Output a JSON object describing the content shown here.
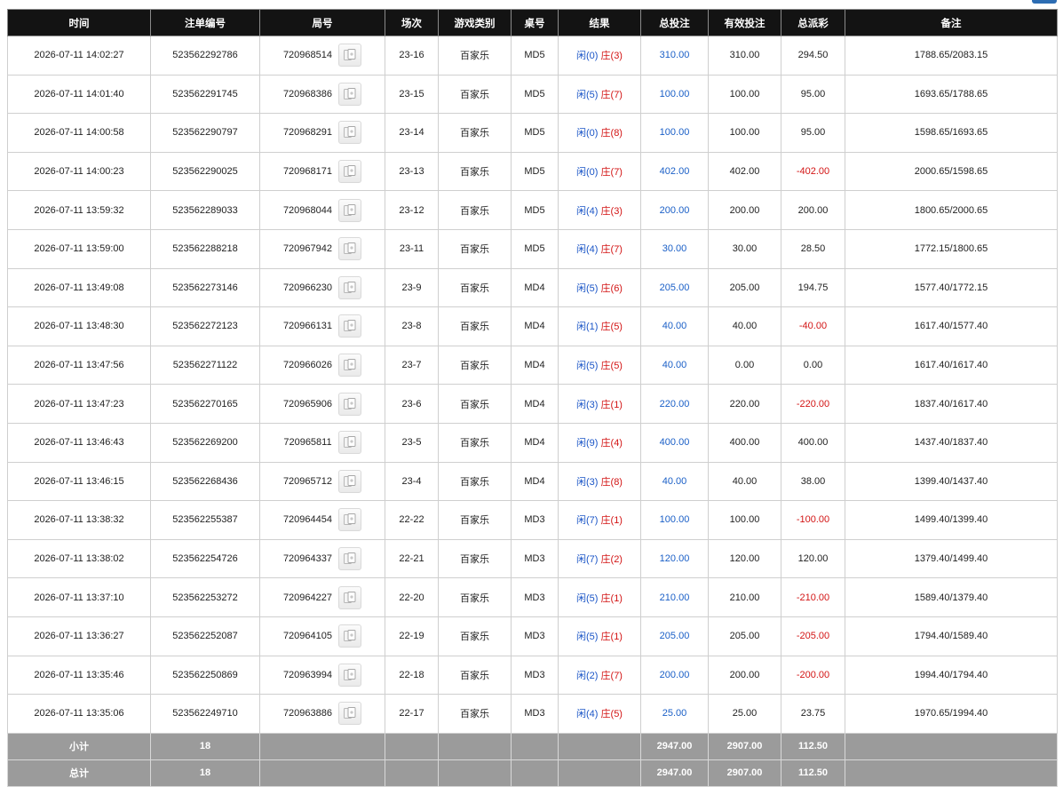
{
  "headers": {
    "time": "时间",
    "order_no": "注单编号",
    "round_no": "局号",
    "shoe": "场次",
    "game_type": "游戏类别",
    "table": "桌号",
    "result": "结果",
    "total_bet": "总投注",
    "valid_bet": "有效投注",
    "total_payout": "总派彩",
    "remark": "备注"
  },
  "result_labels": {
    "player": "闲",
    "banker": "庄"
  },
  "icons": {
    "detail": "card-detail-icon"
  },
  "colors": {
    "header_bg": "#131313",
    "player": "#1a55c7",
    "banker": "#d31515",
    "positive_bet": "#1a5fc7",
    "loss": "#d31515",
    "summary_bg": "#9b9b9b"
  },
  "rows": [
    {
      "time": "2026-07-11 14:02:27",
      "order_no": "523562292786",
      "round_no": "720968514",
      "shoe": "23-16",
      "game_type": "百家乐",
      "table": "MD5",
      "player": "(0)",
      "banker": "(3)",
      "total_bet": "310.00",
      "valid_bet": "310.00",
      "payout": "294.50",
      "payout_negative": false,
      "remark": "1788.65/2083.15"
    },
    {
      "time": "2026-07-11 14:01:40",
      "order_no": "523562291745",
      "round_no": "720968386",
      "shoe": "23-15",
      "game_type": "百家乐",
      "table": "MD5",
      "player": "(5)",
      "banker": "(7)",
      "total_bet": "100.00",
      "valid_bet": "100.00",
      "payout": "95.00",
      "payout_negative": false,
      "remark": "1693.65/1788.65"
    },
    {
      "time": "2026-07-11 14:00:58",
      "order_no": "523562290797",
      "round_no": "720968291",
      "shoe": "23-14",
      "game_type": "百家乐",
      "table": "MD5",
      "player": "(0)",
      "banker": "(8)",
      "total_bet": "100.00",
      "valid_bet": "100.00",
      "payout": "95.00",
      "payout_negative": false,
      "remark": "1598.65/1693.65"
    },
    {
      "time": "2026-07-11 14:00:23",
      "order_no": "523562290025",
      "round_no": "720968171",
      "shoe": "23-13",
      "game_type": "百家乐",
      "table": "MD5",
      "player": "(0)",
      "banker": "(7)",
      "total_bet": "402.00",
      "valid_bet": "402.00",
      "payout": "-402.00",
      "payout_negative": true,
      "remark": "2000.65/1598.65"
    },
    {
      "time": "2026-07-11 13:59:32",
      "order_no": "523562289033",
      "round_no": "720968044",
      "shoe": "23-12",
      "game_type": "百家乐",
      "table": "MD5",
      "player": "(4)",
      "banker": "(3)",
      "total_bet": "200.00",
      "valid_bet": "200.00",
      "payout": "200.00",
      "payout_negative": false,
      "remark": "1800.65/2000.65"
    },
    {
      "time": "2026-07-11 13:59:00",
      "order_no": "523562288218",
      "round_no": "720967942",
      "shoe": "23-11",
      "game_type": "百家乐",
      "table": "MD5",
      "player": "(4)",
      "banker": "(7)",
      "total_bet": "30.00",
      "valid_bet": "30.00",
      "payout": "28.50",
      "payout_negative": false,
      "remark": "1772.15/1800.65"
    },
    {
      "time": "2026-07-11 13:49:08",
      "order_no": "523562273146",
      "round_no": "720966230",
      "shoe": "23-9",
      "game_type": "百家乐",
      "table": "MD4",
      "player": "(5)",
      "banker": "(6)",
      "total_bet": "205.00",
      "valid_bet": "205.00",
      "payout": "194.75",
      "payout_negative": false,
      "remark": "1577.40/1772.15"
    },
    {
      "time": "2026-07-11 13:48:30",
      "order_no": "523562272123",
      "round_no": "720966131",
      "shoe": "23-8",
      "game_type": "百家乐",
      "table": "MD4",
      "player": "(1)",
      "banker": "(5)",
      "total_bet": "40.00",
      "valid_bet": "40.00",
      "payout": "-40.00",
      "payout_negative": true,
      "remark": "1617.40/1577.40"
    },
    {
      "time": "2026-07-11 13:47:56",
      "order_no": "523562271122",
      "round_no": "720966026",
      "shoe": "23-7",
      "game_type": "百家乐",
      "table": "MD4",
      "player": "(5)",
      "banker": "(5)",
      "total_bet": "40.00",
      "valid_bet": "0.00",
      "payout": "0.00",
      "payout_negative": false,
      "remark": "1617.40/1617.40"
    },
    {
      "time": "2026-07-11 13:47:23",
      "order_no": "523562270165",
      "round_no": "720965906",
      "shoe": "23-6",
      "game_type": "百家乐",
      "table": "MD4",
      "player": "(3)",
      "banker": "(1)",
      "total_bet": "220.00",
      "valid_bet": "220.00",
      "payout": "-220.00",
      "payout_negative": true,
      "remark": "1837.40/1617.40"
    },
    {
      "time": "2026-07-11 13:46:43",
      "order_no": "523562269200",
      "round_no": "720965811",
      "shoe": "23-5",
      "game_type": "百家乐",
      "table": "MD4",
      "player": "(9)",
      "banker": "(4)",
      "total_bet": "400.00",
      "valid_bet": "400.00",
      "payout": "400.00",
      "payout_negative": false,
      "remark": "1437.40/1837.40"
    },
    {
      "time": "2026-07-11 13:46:15",
      "order_no": "523562268436",
      "round_no": "720965712",
      "shoe": "23-4",
      "game_type": "百家乐",
      "table": "MD4",
      "player": "(3)",
      "banker": "(8)",
      "total_bet": "40.00",
      "valid_bet": "40.00",
      "payout": "38.00",
      "payout_negative": false,
      "remark": "1399.40/1437.40"
    },
    {
      "time": "2026-07-11 13:38:32",
      "order_no": "523562255387",
      "round_no": "720964454",
      "shoe": "22-22",
      "game_type": "百家乐",
      "table": "MD3",
      "player": "(7)",
      "banker": "(1)",
      "total_bet": "100.00",
      "valid_bet": "100.00",
      "payout": "-100.00",
      "payout_negative": true,
      "remark": "1499.40/1399.40"
    },
    {
      "time": "2026-07-11 13:38:02",
      "order_no": "523562254726",
      "round_no": "720964337",
      "shoe": "22-21",
      "game_type": "百家乐",
      "table": "MD3",
      "player": "(7)",
      "banker": "(2)",
      "total_bet": "120.00",
      "valid_bet": "120.00",
      "payout": "120.00",
      "payout_negative": false,
      "remark": "1379.40/1499.40"
    },
    {
      "time": "2026-07-11 13:37:10",
      "order_no": "523562253272",
      "round_no": "720964227",
      "shoe": "22-20",
      "game_type": "百家乐",
      "table": "MD3",
      "player": "(5)",
      "banker": "(1)",
      "total_bet": "210.00",
      "valid_bet": "210.00",
      "payout": "-210.00",
      "payout_negative": true,
      "remark": "1589.40/1379.40"
    },
    {
      "time": "2026-07-11 13:36:27",
      "order_no": "523562252087",
      "round_no": "720964105",
      "shoe": "22-19",
      "game_type": "百家乐",
      "table": "MD3",
      "player": "(5)",
      "banker": "(1)",
      "total_bet": "205.00",
      "valid_bet": "205.00",
      "payout": "-205.00",
      "payout_negative": true,
      "remark": "1794.40/1589.40"
    },
    {
      "time": "2026-07-11 13:35:46",
      "order_no": "523562250869",
      "round_no": "720963994",
      "shoe": "22-18",
      "game_type": "百家乐",
      "table": "MD3",
      "player": "(2)",
      "banker": "(7)",
      "total_bet": "200.00",
      "valid_bet": "200.00",
      "payout": "-200.00",
      "payout_negative": true,
      "remark": "1994.40/1794.40"
    },
    {
      "time": "2026-07-11 13:35:06",
      "order_no": "523562249710",
      "round_no": "720963886",
      "shoe": "22-17",
      "game_type": "百家乐",
      "table": "MD3",
      "player": "(4)",
      "banker": "(5)",
      "total_bet": "25.00",
      "valid_bet": "25.00",
      "payout": "23.75",
      "payout_negative": false,
      "remark": "1970.65/1994.40"
    }
  ],
  "subtotal": {
    "label": "小计",
    "count": "18",
    "total_bet": "2947.00",
    "valid_bet": "2907.00",
    "payout": "112.50"
  },
  "grand_total": {
    "label": "总计",
    "count": "18",
    "total_bet": "2947.00",
    "valid_bet": "2907.00",
    "payout": "112.50"
  }
}
